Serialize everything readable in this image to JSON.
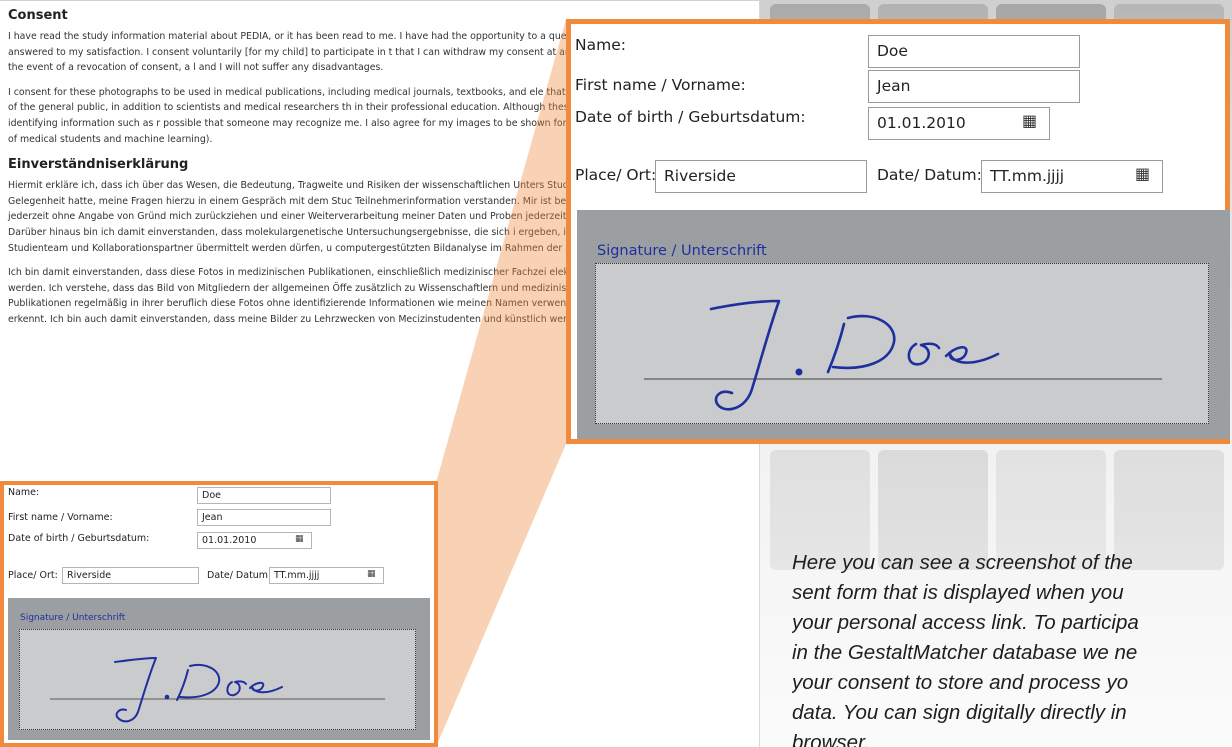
{
  "document": {
    "consent_heading": "Consent",
    "consent_paragraphs": [
      "I have read the study information material about PEDIA, or it has been read to me. I have had the opportunity to a questions that I have asked were answered to my satisfaction. I consent voluntarily [for my child] to participate in t that I can withdraw my consent at any time and without giving reasons. In the event of a revocation of consent, a l and I will not suffer any disadvantages.",
      "I consent for these photographs to be used in medical publications, including medical journals, textbooks, and ele that the image may be seen by members of the general public, in addition to scientists and medical researchers th in their professional education. Although these photographs will be used without identifying information such as r possible that someone may recognize me. I also agree for my images to be shown for training purposes of human (teaching of medical students and machine learning)."
    ],
    "einverstaendnis_heading": "Einverständniserklärung",
    "einverstaendnis_paragraphs": [
      "Hiermit erkläre ich, dass ich über das Wesen, die Bedeutung, Tragweite und Risiken der wissenschaftlichen Unters Studie informiert wurde und ausreichend Gelegenheit hatte, meine Fragen hierzu in einem Gespräch mit dem Stuc Teilnehmerinformation verstanden. Mir ist bekannt, dass ich meine Einwilligung jederzeit ohne Angabe von Gründ mich zurückziehen und einer Weiterverarbeitung meiner Daten und Proben jederzeit widersprechen und ihre Lösc kann. Darüber hinaus bin ich damit einverstanden, dass molekulargenetische Untersuchungsergebnisse, die sich i ergeben, in pseudonymisierter Form an das Studienteam und Kollaborationspartner übermittelt werden dürfen, u computergestützten Bildanalyse im Rahmen der Studie zu ermitteln.",
      "Ich bin damit einverstanden, dass diese Fotos in medizinischen Publikationen, einschließlich medizinischer Fachzei elektronischer Publikationen, verwendet werden. Ich verstehe, dass das Bild von Mitgliedern der allgemeinen Öffe zusätzlich zu Wissenschaftlern und medizinischen Forschern, die diese Publikationen regelmäßig in ihrer beruflich diese Fotos ohne identifizierende Informationen wie meinen Namen verwendet werden, ist mir bewusst, dass es r erkennt. Ich bin auch damit einverstanden, dass meine Bilder zu Lehrzwecken von Mecizinstudenten und künstlich werden."
    ]
  },
  "form": {
    "name_label": "Name:",
    "name_value": "Doe",
    "first_name_label": "First name / Vorname:",
    "first_name_value": "Jean",
    "dob_label": "Date of birth / Geburtsdatum:",
    "dob_value": "01.01.2010",
    "place_label": "Place/ Ort:",
    "place_value": "Riverside",
    "date_label": "Date/ Datum:",
    "date_value": "TT.mm.jjjj",
    "signature_label": "Signature / Unterschrift",
    "signature_text": "J. Doe"
  },
  "caption": {
    "lines": [
      "Here you can see a screenshot of the",
      "sent form that is displayed when you",
      "your personal access link. To participa",
      "in the GestaltMatcher database we ne",
      "your consent to store and process yo",
      "data. You can sign digitally directly in",
      "browser."
    ]
  },
  "colors": {
    "highlight_orange": "#f08a3c",
    "signature_panel": "#9c9fa2",
    "signature_pad": "#c9cbcc",
    "signature_ink": "#1f2f9e"
  }
}
